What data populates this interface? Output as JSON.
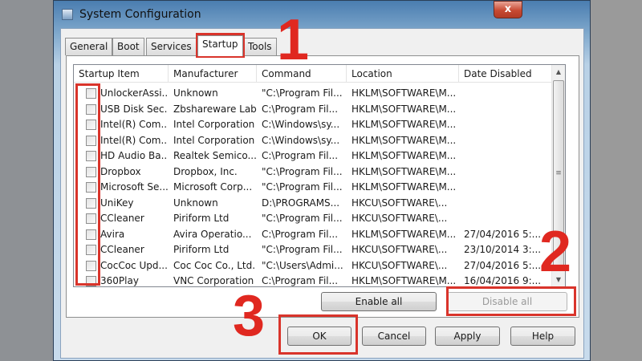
{
  "window": {
    "title": "System Configuration",
    "close_label": "x"
  },
  "tabs": [
    {
      "label": "General"
    },
    {
      "label": "Boot"
    },
    {
      "label": "Services"
    },
    {
      "label": "Startup"
    },
    {
      "label": "Tools"
    }
  ],
  "columns": [
    "Startup Item",
    "Manufacturer",
    "Command",
    "Location",
    "Date Disabled"
  ],
  "rows": [
    {
      "item": "UnlockerAssi...",
      "manufacturer": "Unknown",
      "command": "\"C:\\Program Fil...",
      "location": "HKLM\\SOFTWARE\\M...",
      "date": ""
    },
    {
      "item": "USB Disk Sec...",
      "manufacturer": "Zbshareware Lab",
      "command": "C:\\Program Fil...",
      "location": "HKLM\\SOFTWARE\\M...",
      "date": ""
    },
    {
      "item": "Intel(R) Com...",
      "manufacturer": "Intel Corporation",
      "command": "C:\\Windows\\sy...",
      "location": "HKLM\\SOFTWARE\\M...",
      "date": ""
    },
    {
      "item": "Intel(R) Com...",
      "manufacturer": "Intel Corporation",
      "command": "C:\\Windows\\sy...",
      "location": "HKLM\\SOFTWARE\\M...",
      "date": ""
    },
    {
      "item": "HD Audio Ba...",
      "manufacturer": "Realtek Semico...",
      "command": "C:\\Program Fil...",
      "location": "HKLM\\SOFTWARE\\M...",
      "date": ""
    },
    {
      "item": "Dropbox",
      "manufacturer": "Dropbox, Inc.",
      "command": "\"C:\\Program Fil...",
      "location": "HKLM\\SOFTWARE\\M...",
      "date": ""
    },
    {
      "item": "Microsoft Se...",
      "manufacturer": "Microsoft Corp...",
      "command": "\"C:\\Program Fil...",
      "location": "HKLM\\SOFTWARE\\M...",
      "date": ""
    },
    {
      "item": "UniKey",
      "manufacturer": "Unknown",
      "command": "D:\\PROGRAMS...",
      "location": "HKCU\\SOFTWARE\\...",
      "date": ""
    },
    {
      "item": "CCleaner",
      "manufacturer": "Piriform Ltd",
      "command": "\"C:\\Program Fil...",
      "location": "HKCU\\SOFTWARE\\...",
      "date": ""
    },
    {
      "item": "Avira",
      "manufacturer": "Avira Operatio...",
      "command": "C:\\Program Fil...",
      "location": "HKLM\\SOFTWARE\\M...",
      "date": "27/04/2016 5:..."
    },
    {
      "item": "CCleaner",
      "manufacturer": "Piriform Ltd",
      "command": "\"C:\\Program Fil...",
      "location": "HKCU\\SOFTWARE\\...",
      "date": "23/10/2014 3:..."
    },
    {
      "item": "CocCoc Upd...",
      "manufacturer": "Coc Coc Co., Ltd.",
      "command": "\"C:\\Users\\Admi...",
      "location": "HKCU\\SOFTWARE\\...",
      "date": "27/04/2016 5:..."
    },
    {
      "item": "360Play",
      "manufacturer": "VNC Corporation",
      "command": "C:\\Program Fil...",
      "location": "HKLM\\SOFTWARE\\M...",
      "date": "16/04/2016 9:..."
    }
  ],
  "buttons": {
    "enable_all": "Enable all",
    "disable_all": "Disable all",
    "ok": "OK",
    "cancel": "Cancel",
    "apply": "Apply",
    "help": "Help"
  },
  "annotations": [
    "1",
    "2",
    "3"
  ],
  "colors": {
    "annotation": "#e02820"
  }
}
